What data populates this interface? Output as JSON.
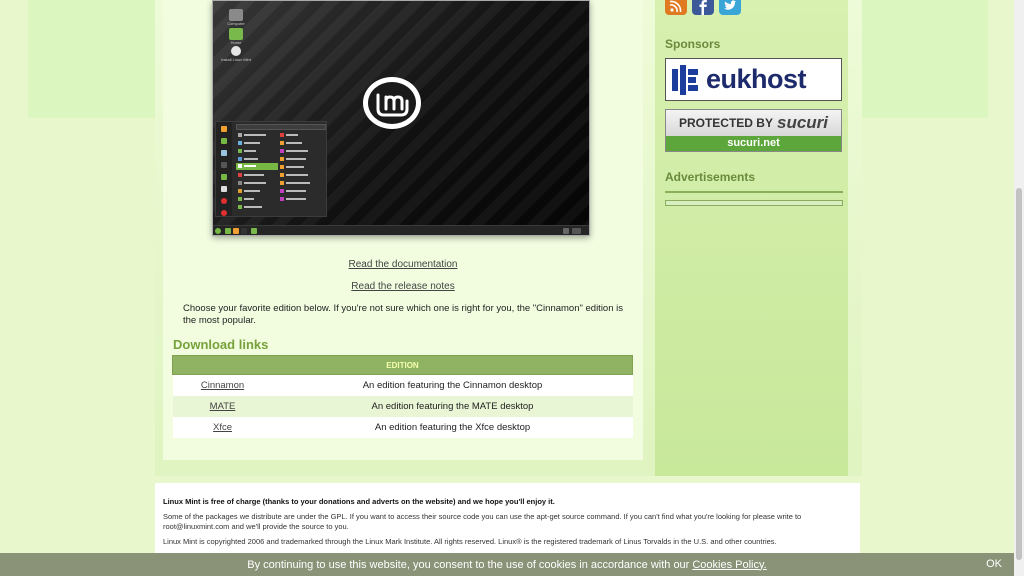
{
  "screenshot": {
    "desktop_icons": [
      "Computer",
      "Home",
      "Install Linux Mint"
    ]
  },
  "links": {
    "documentation": "Read the documentation",
    "release_notes": "Read the release notes"
  },
  "intro_text": "Choose your favorite edition below. If you're not sure which one is right for you, the \"Cinnamon\" edition is the most popular.",
  "downloads": {
    "heading": "Download links",
    "column_header": "EDITION",
    "rows": [
      {
        "name": "Cinnamon",
        "description": "An edition featuring the Cinnamon desktop"
      },
      {
        "name": "MATE",
        "description": "An edition featuring the MATE desktop"
      },
      {
        "name": "Xfce",
        "description": "An edition featuring the Xfce desktop"
      }
    ]
  },
  "sidebar": {
    "social_icons": [
      "rss-icon",
      "facebook-icon",
      "twitter-icon"
    ],
    "sponsors_title": "Sponsors",
    "sponsor1": "eukhost",
    "sponsor2_top": "PROTECTED BY",
    "sponsor2_brand": "sucuri",
    "sponsor2_bottom": "sucuri.net",
    "ads_title": "Advertisements"
  },
  "footer": {
    "line1": "Linux Mint is free of charge (thanks to your donations and adverts on the website) and we hope you'll enjoy it.",
    "line2": "Some of the packages we distribute are under the GPL. If you want to access their source code you can use the apt-get source command. If you can't find what you're looking for please write to root@linuxmint.com and we'll provide the source to you.",
    "line3": "Linux Mint is copyrighted 2006 and trademarked through the Linux Mark Institute. All rights reserved. Linux® is the registered trademark of Linus Torvalds in the U.S. and other countries."
  },
  "cookie": {
    "text": "By continuing to use this website, you consent to the use of cookies in accordance with our",
    "link": "Cookies Policy.",
    "ok": "OK"
  },
  "colors": {
    "accent_green": "#77a13a",
    "table_header": "#8fb363",
    "cookie_bar": "#8a9377"
  }
}
